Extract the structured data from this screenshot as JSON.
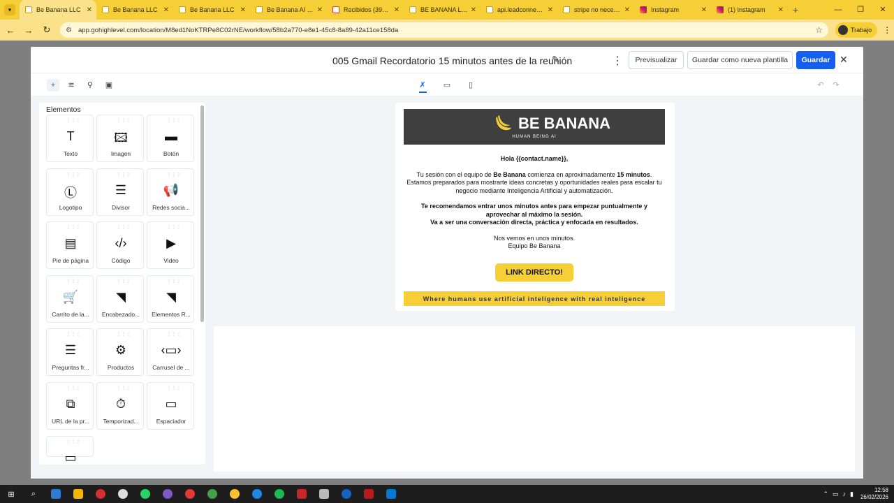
{
  "browser": {
    "tabs": [
      {
        "label": "Be Banana LLC",
        "favicon": "banana-icon",
        "active": true
      },
      {
        "label": "Be Banana LLC",
        "favicon": "banana-icon",
        "active": false
      },
      {
        "label": "Be Banana LLC",
        "favicon": "banana-icon",
        "active": false
      },
      {
        "label": "Be Banana AI - Sc",
        "favicon": "page-icon",
        "active": false
      },
      {
        "label": "Recibidos (396) -",
        "favicon": "gmail-icon",
        "active": false
      },
      {
        "label": "BE BANANA LLC",
        "favicon": "page-icon",
        "active": false
      },
      {
        "label": "api.leadconnecto",
        "favicon": "globe-icon",
        "active": false
      },
      {
        "label": "stripe no necesito",
        "favicon": "google-icon",
        "active": false
      },
      {
        "label": "Instagram",
        "favicon": "instagram-icon",
        "active": false
      },
      {
        "label": "(1) Instagram",
        "favicon": "instagram-icon",
        "active": false
      }
    ],
    "url": "app.gohighlevel.com/location/M8ed1NoKTRPe8C02rNE/workflow/58b2a770-e8e1-45c8-8a89-42a11ce158da",
    "profile_label": "Trabajo"
  },
  "modal": {
    "title": "005 Gmail Recordatorio 15 minutos antes de la reunión",
    "preview_label": "Previsualizar",
    "save_template_label": "Guardar como nueva plantilla",
    "save_label": "Guardar"
  },
  "sidebar": {
    "title": "Elementos",
    "elements": [
      {
        "label": "Texto",
        "icon": "text-icon"
      },
      {
        "label": "Imagen",
        "icon": "image-icon"
      },
      {
        "label": "Botón",
        "icon": "button-icon"
      },
      {
        "label": "Logotipo",
        "icon": "logo-icon"
      },
      {
        "label": "Divisor",
        "icon": "divider-icon"
      },
      {
        "label": "Redes socia...",
        "icon": "social-icon"
      },
      {
        "label": "Pie de página",
        "icon": "footer-icon"
      },
      {
        "label": "Código",
        "icon": "code-icon"
      },
      {
        "label": "Video",
        "icon": "video-icon"
      },
      {
        "label": "Carrito de la...",
        "icon": "cart-icon"
      },
      {
        "label": "Encabezado...",
        "icon": "rss-icon"
      },
      {
        "label": "Elementos R...",
        "icon": "rss-icon"
      },
      {
        "label": "Preguntas fr...",
        "icon": "faq-icon"
      },
      {
        "label": "Productos",
        "icon": "products-icon"
      },
      {
        "label": "Carrusel de ...",
        "icon": "carousel-icon"
      },
      {
        "label": "URL de la pr...",
        "icon": "url-icon"
      },
      {
        "label": "Temporizad...",
        "icon": "timer-icon"
      },
      {
        "label": "Espaciador",
        "icon": "spacer-icon"
      },
      {
        "label": "",
        "icon": "more-icon"
      }
    ]
  },
  "email": {
    "brand": "BE BANANA",
    "tagline": "HUMAN BEING AI",
    "greeting": "Hola {{contact.name}},",
    "p1_a": "Tu sesión con el equipo de ",
    "p1_brand": "Be Banana",
    "p1_b": " comienza en aproximadamente ",
    "p1_time": "15 minutos",
    "p1_c": ". Estamos preparados para mostrarte ideas concretas y oportunidades reales para escalar tu negocio mediante Inteligencia Artificial y automatización.",
    "p2_a": "Te recomendamos entrar unos minutos antes para empezar puntualmente y aprovechar al máximo la sesión.",
    "p2_b": "Va a ser una conversación directa, práctica y enfocada en resultados.",
    "sign_a": "Nos vemos en unos minutos.",
    "sign_b": "Equipo Be Banana",
    "cta": "LINK DIRECTO!",
    "footer": "Where humans use artificial inteligence with real inteligence"
  },
  "taskbar": {
    "time": "12:58",
    "date": "26/02/2026"
  },
  "colors": {
    "accent": "#f6ce35",
    "primary_button": "#155eef",
    "email_header": "#3f3f3f"
  }
}
